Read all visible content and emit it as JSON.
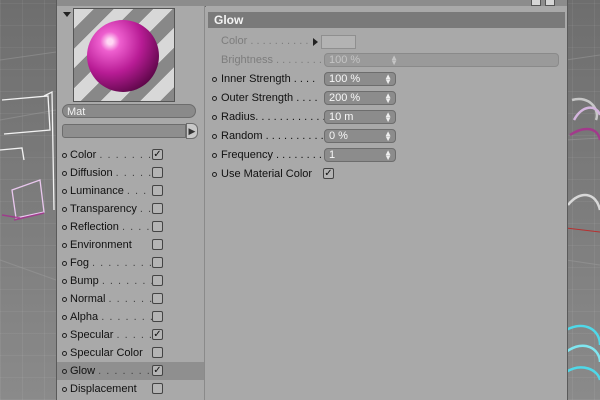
{
  "preview": {
    "material_name": "Mat"
  },
  "channels": [
    {
      "label": "Color",
      "dots": ". . . . . . .",
      "checked": true,
      "active": false
    },
    {
      "label": "Diffusion",
      "dots": ". . . . .",
      "checked": false,
      "active": false
    },
    {
      "label": "Luminance",
      "dots": ". . . .",
      "checked": false,
      "active": false
    },
    {
      "label": "Transparency",
      "dots": ". .",
      "checked": false,
      "active": false
    },
    {
      "label": "Reflection",
      "dots": ". . . .",
      "checked": false,
      "active": false
    },
    {
      "label": "Environment",
      "dots": "",
      "checked": false,
      "active": false
    },
    {
      "label": "Fog",
      "dots": ". . . . . . . .",
      "checked": false,
      "active": false
    },
    {
      "label": "Bump",
      "dots": ". . . . . . .",
      "checked": false,
      "active": false
    },
    {
      "label": "Normal",
      "dots": ". . . . . .",
      "checked": false,
      "active": false
    },
    {
      "label": "Alpha",
      "dots": ". . . . . . .",
      "checked": false,
      "active": false
    },
    {
      "label": "Specular",
      "dots": ". . . . .",
      "checked": true,
      "active": false
    },
    {
      "label": "Specular Color",
      "dots": "",
      "checked": false,
      "active": false
    },
    {
      "label": "Glow",
      "dots": ". . . . . . . .",
      "checked": true,
      "active": true
    },
    {
      "label": "Displacement",
      "dots": "",
      "checked": false,
      "active": false
    }
  ],
  "panel": {
    "title": "Glow",
    "color_label": "Color . . . . . . . . . .",
    "brightness": {
      "label": "Brightness . . . . . . . .",
      "value": "100 %"
    },
    "inner_strength": {
      "label": "Inner Strength . . . .",
      "value": "100 %"
    },
    "outer_strength": {
      "label": "Outer Strength . . . .",
      "value": "200 %"
    },
    "radius": {
      "label": "Radius. . . . . . . . . . . .",
      "value": "10 m"
    },
    "random": {
      "label": "Random . . . . . . . . . .",
      "value": "0 %"
    },
    "frequency": {
      "label": "Frequency . . . . . . . .",
      "value": "1"
    },
    "use_material_color": {
      "label": "Use Material Color",
      "checked": true
    }
  },
  "icons": {
    "check": "✓",
    "spin": "▲▼",
    "slider_arrow": "▶"
  },
  "colors": {
    "panel_bg": "#a9a9a9",
    "header_bg": "#7a7a7a",
    "sphere": "#b81c95",
    "glow_accent": "#4fd8e8"
  }
}
